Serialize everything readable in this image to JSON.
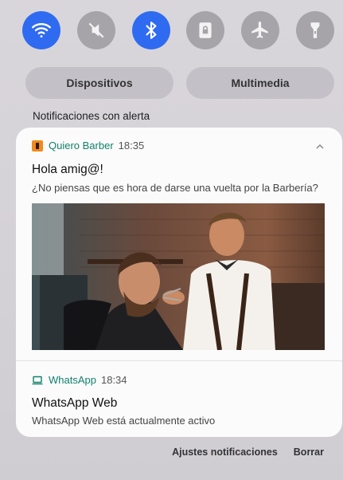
{
  "quick_settings": [
    {
      "icon": "wifi-icon",
      "state": "on"
    },
    {
      "icon": "mute-icon",
      "state": "off"
    },
    {
      "icon": "bluetooth-icon",
      "state": "on"
    },
    {
      "icon": "lock-rotation-icon",
      "state": "off"
    },
    {
      "icon": "airplane-icon",
      "state": "off"
    },
    {
      "icon": "flashlight-icon",
      "state": "off"
    }
  ],
  "pills": {
    "devices": "Dispositivos",
    "media": "Multimedia"
  },
  "section_title": "Notificaciones con alerta",
  "notifications": [
    {
      "app": "Quiero Barber",
      "time": "18:35",
      "title": "Hola amig@!",
      "text": "¿No piensas que es hora de darse una vuelta por la Barbería?"
    },
    {
      "app": "WhatsApp",
      "time": "18:34",
      "title": "WhatsApp Web",
      "text": "WhatsApp Web está actualmente activo"
    }
  ],
  "footer": {
    "settings": "Ajustes notificaciones",
    "clear": "Borrar"
  },
  "colors": {
    "accent": "#2f6bf1",
    "app_name": "#12806c",
    "app_icon": "#f08a1b"
  }
}
